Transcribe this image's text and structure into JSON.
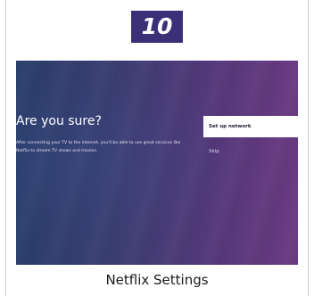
{
  "step_number": "10",
  "screen": {
    "title": "Are you sure?",
    "body": "After connecting your TV to the internet, you'll be able to use great services like Netflix to stream TV shows and movies.",
    "options": [
      {
        "label": "Set up network",
        "selected": true
      },
      {
        "label": "Skip",
        "selected": false
      }
    ]
  },
  "caption": "Netflix Settings",
  "colors": {
    "badge": "#3b2f78",
    "background_left": "#2a3e6c",
    "background_right": "#6b3a82",
    "selected_option": "#ffffff"
  }
}
